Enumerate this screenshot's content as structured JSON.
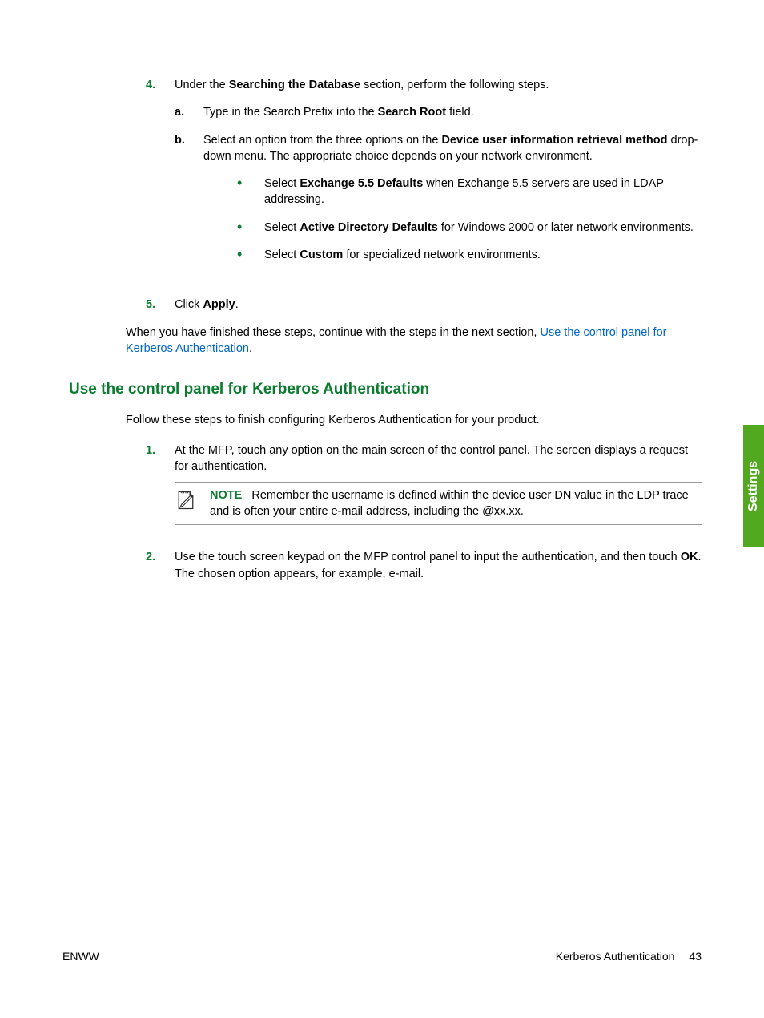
{
  "step4": {
    "num": "4.",
    "text_pre": "Under the ",
    "text_bold": "Searching the Database",
    "text_post": " section, perform the following steps.",
    "a": {
      "num": "a.",
      "pre": "Type in the Search Prefix into the ",
      "bold": "Search Root",
      "post": " field."
    },
    "b": {
      "num": "b.",
      "pre": "Select an option from the three options on the ",
      "bold": "Device user information retrieval method",
      "post": " drop-down menu. The appropriate choice depends on your network environment.",
      "bullets": {
        "i1": {
          "pre": "Select ",
          "bold": "Exchange 5.5 Defaults",
          "post": " when Exchange 5.5 servers are used in LDAP addressing."
        },
        "i2": {
          "pre": "Select ",
          "bold": "Active Directory Defaults",
          "post": " for Windows 2000 or later network environments."
        },
        "i3": {
          "pre": "Select ",
          "bold": "Custom",
          "post": " for specialized network environments."
        }
      }
    }
  },
  "step5": {
    "num": "5.",
    "pre": "Click ",
    "bold": "Apply",
    "post": "."
  },
  "continue": {
    "pre": "When you have finished these steps, continue with the steps in the next section, ",
    "link": "Use the control panel for Kerberos Authentication",
    "post": "."
  },
  "heading": "Use the control panel for Kerberos Authentication",
  "follow": "Follow these steps to finish configuring Kerberos Authentication for your product.",
  "p1": {
    "num": "1.",
    "text": "At the MFP, touch any option on the main screen of the control panel. The screen displays a request for authentication.",
    "note_label": "NOTE",
    "note_text": "Remember the username is defined within the device user DN value in the LDP trace and is often your entire e-mail address, including the @xx.xx."
  },
  "p2": {
    "num": "2.",
    "pre": "Use the touch screen keypad on the MFP control panel to input the authentication, and then touch ",
    "bold": "OK",
    "post": ". The chosen option appears, for example, e-mail."
  },
  "tab": "Settings",
  "footer": {
    "left": "ENWW",
    "center": "Kerberos Authentication",
    "page": "43"
  }
}
